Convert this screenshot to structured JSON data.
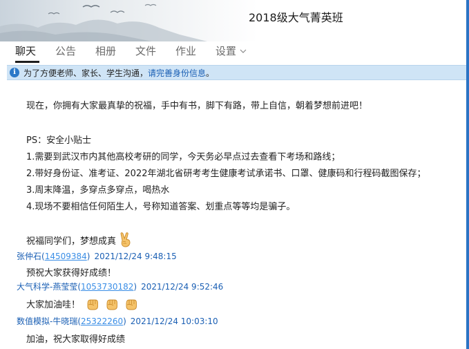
{
  "window": {
    "title": "2018级大气菁英班"
  },
  "tabs": [
    {
      "label": "聊天"
    },
    {
      "label": "公告"
    },
    {
      "label": "相册"
    },
    {
      "label": "文件"
    },
    {
      "label": "作业"
    },
    {
      "label": "设置"
    }
  ],
  "notice": {
    "text": "为了方便老师、家长、学生沟通，",
    "link": "请完善身份信息",
    "suffix": "。"
  },
  "announcement": {
    "lines": [
      "现在，你拥有大家最真挚的祝福，手中有书，脚下有路，带上自信，朝着梦想前进吧！",
      "PS：安全小贴士",
      "1.需要到武汉市内其他高校考研的同学，今天务必早点过去查看下考场和路线；",
      "2.带好身份证、准考证、2022年湖北省研考考生健康考试承诺书、口罩、健康码和行程码截图保存；",
      "3.周末降温，多穿点多穿点，喝热水",
      "4.现场不要相信任何陌生人，号称知道答案、划重点等等均是骗子。",
      "祝福同学们，梦想成真"
    ],
    "emoji": "victory-hand-icon"
  },
  "messages": [
    {
      "sender": "张仲石",
      "qq": "14509384",
      "time": "2021/12/24 9:48:15",
      "text": "预祝大家获得好成绩！"
    },
    {
      "sender": "大气科学-燕莹莹",
      "qq": "1053730182",
      "time": "2021/12/24 9:52:46",
      "text": "大家加油哇！"
    },
    {
      "sender": "数值模拟-牛晓瑞",
      "qq": "25322260",
      "time": "2021/12/24 10:03:10",
      "text": "加油，祝大家取得好成绩"
    }
  ],
  "colors": {
    "accent": "#1a5fb4",
    "notice_bg": "#cfe4f6",
    "scrollbar": "#2b73c4"
  }
}
